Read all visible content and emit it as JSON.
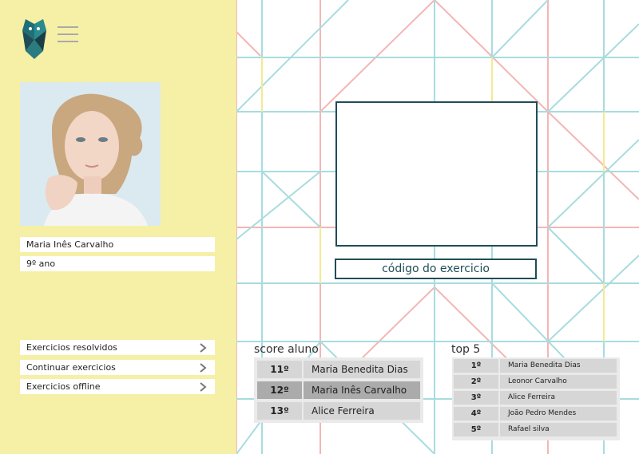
{
  "sidebar": {
    "student": {
      "name": "Maria Inês Carvalho",
      "grade": "9º ano"
    },
    "menu_icon": "hamburger-icon",
    "logo_icon": "owl-logo-icon",
    "nav": [
      {
        "label": "Exercicios resolvidos",
        "icon": "chevron-right-icon"
      },
      {
        "label": "Continuar exercicios",
        "icon": "chevron-right-icon"
      },
      {
        "label": "Exercicios offline",
        "icon": "chevron-right-icon"
      }
    ]
  },
  "main": {
    "exercise_code_placeholder": "código do exercicio",
    "score": {
      "title": "score aluno",
      "rows": [
        {
          "pos": "11º",
          "name": "Maria Benedita Dias"
        },
        {
          "pos": "12º",
          "name": "Maria Inês Carvalho"
        },
        {
          "pos": "13º",
          "name": "Alice Ferreira"
        }
      ]
    },
    "top5": {
      "title": "top 5",
      "rows": [
        {
          "pos": "1º",
          "name": "Maria Benedita Dias"
        },
        {
          "pos": "2º",
          "name": "Leonor Carvalho"
        },
        {
          "pos": "3º",
          "name": "Alice Ferreira"
        },
        {
          "pos": "4º",
          "name": "João Pedro Mendes"
        },
        {
          "pos": "5º",
          "name": "Rafael silva"
        }
      ]
    }
  },
  "colors": {
    "sidebar_bg": "#f6f0a6",
    "accent": "#1f4d57",
    "pattern_blue": "#a8dcde",
    "pattern_pink": "#f3b6b6",
    "pattern_yellow": "#f4ea93"
  }
}
